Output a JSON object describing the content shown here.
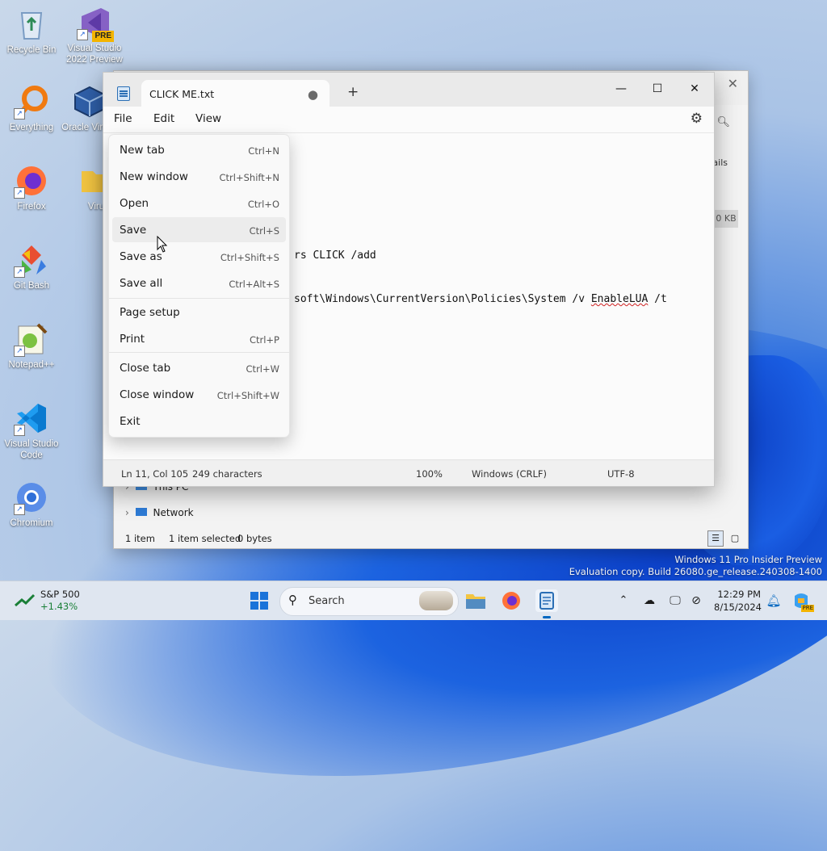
{
  "desktop": {
    "icons": [
      {
        "label": "Recycle Bin"
      },
      {
        "label": "Visual Studio 2022 Preview",
        "badge": "PRE"
      },
      {
        "label": "Everything"
      },
      {
        "label": "Oracle Virtual"
      },
      {
        "label": "Firefox"
      },
      {
        "label": "Viru"
      },
      {
        "label": "Git Bash"
      },
      {
        "label": "Notepad++"
      },
      {
        "label": "Visual Studio Code"
      },
      {
        "label": "Chromium"
      }
    ],
    "watermark": {
      "line1": "Windows 11 Pro Insider Preview",
      "line2": "Evaluation copy. Build 26080.ge_release.240308-1400"
    }
  },
  "explorer": {
    "details_label": "ails",
    "size_cell": "0 KB",
    "nav": [
      "This PC",
      "Network"
    ],
    "status": {
      "items": "1 item",
      "selected": "1 item selected",
      "size": "0 bytes"
    }
  },
  "notepad": {
    "tab_title": "CLICK ME.txt",
    "menus": {
      "file": "File",
      "edit": "Edit",
      "view": "View"
    },
    "editor_lines": [
      "rs CLICK /add",
      "soft\\Windows\\CurrentVersion\\Policies\\System /v ",
      "EnableLUA",
      " /t"
    ],
    "status": {
      "position": "Ln 11, Col 105",
      "characters": "249 characters",
      "zoom": "100%",
      "line_ending": "Windows (CRLF)",
      "encoding": "UTF-8"
    }
  },
  "file_menu": {
    "items": [
      {
        "label": "New tab",
        "shortcut": "Ctrl+N"
      },
      {
        "label": "New window",
        "shortcut": "Ctrl+Shift+N"
      },
      {
        "label": "Open",
        "shortcut": "Ctrl+O"
      },
      {
        "label": "Save",
        "shortcut": "Ctrl+S"
      },
      {
        "label": "Save as",
        "shortcut": "Ctrl+Shift+S"
      },
      {
        "label": "Save all",
        "shortcut": "Ctrl+Alt+S"
      },
      {
        "label": "Page setup",
        "shortcut": ""
      },
      {
        "label": "Print",
        "shortcut": "Ctrl+P"
      },
      {
        "label": "Close tab",
        "shortcut": "Ctrl+W"
      },
      {
        "label": "Close window",
        "shortcut": "Ctrl+Shift+W"
      },
      {
        "label": "Exit",
        "shortcut": ""
      }
    ],
    "hovered": "Save"
  },
  "taskbar": {
    "stock_name": "S&P 500",
    "stock_change": "+1.43%",
    "search_placeholder": "Search",
    "time": "12:29 PM",
    "date": "8/15/2024"
  },
  "colors": {
    "accent": "#0067c0",
    "stock_up": "#1a7f37",
    "spell_error": "#d02020"
  }
}
